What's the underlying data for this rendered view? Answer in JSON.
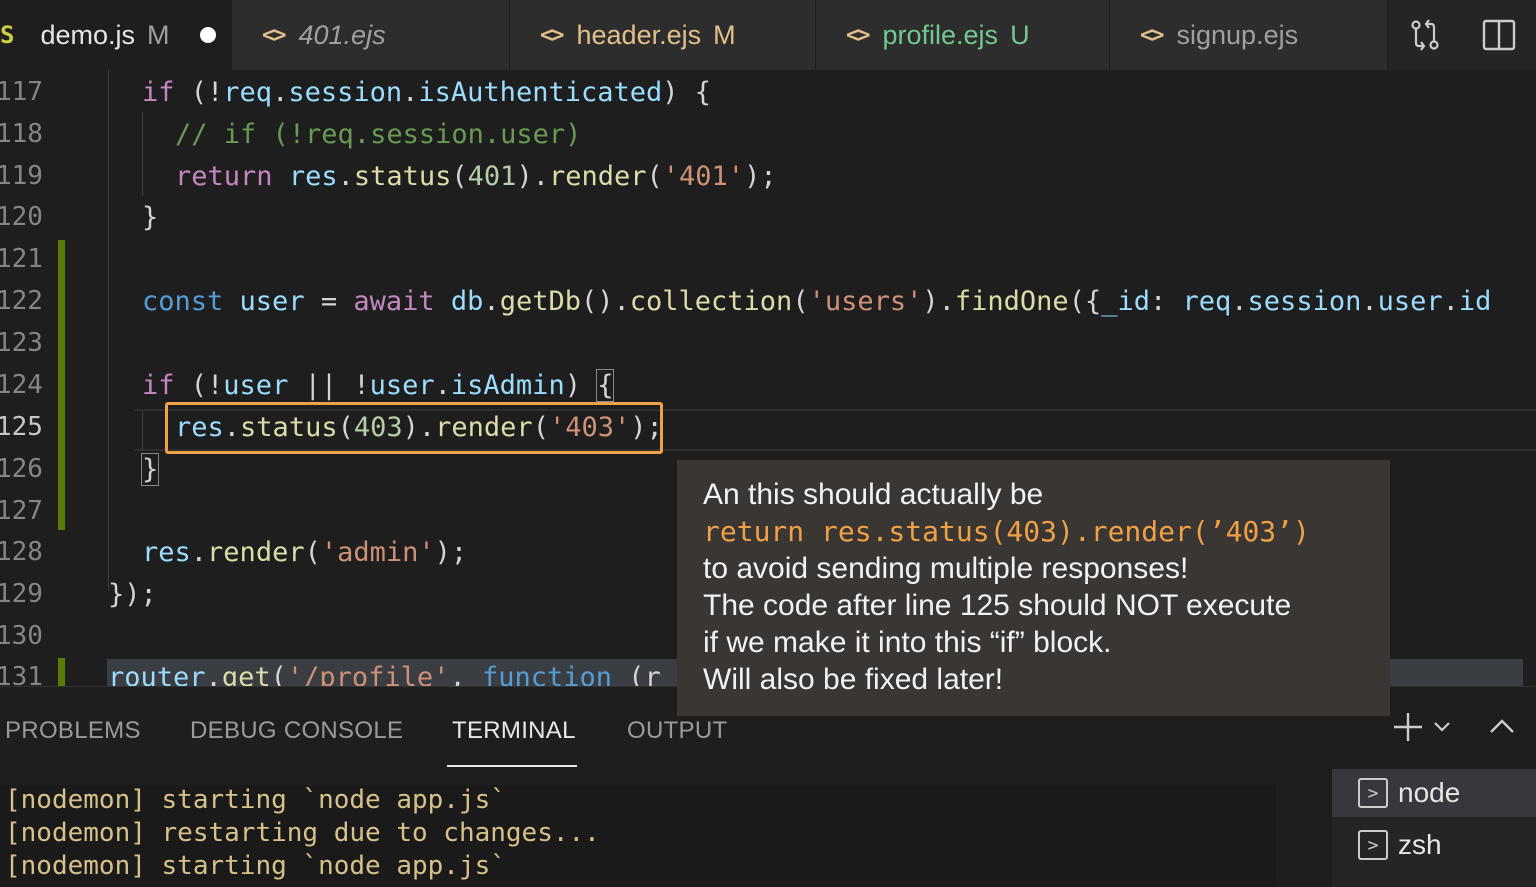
{
  "tabs": [
    {
      "icon": "S",
      "name": "demo.js",
      "status": "M",
      "dirty": true
    },
    {
      "icon": "<>",
      "name": "401.ejs",
      "status": ""
    },
    {
      "icon": "<>",
      "name": "header.ejs",
      "status": "M"
    },
    {
      "icon": "<>",
      "name": "profile.ejs",
      "status": "U"
    },
    {
      "icon": "<>",
      "name": "signup.ejs",
      "status": ""
    }
  ],
  "editor": {
    "line_numbers": [
      "117",
      "118",
      "119",
      "120",
      "121",
      "122",
      "123",
      "124",
      "125",
      "126",
      "127",
      "128",
      "129",
      "130",
      "131"
    ],
    "current_line": "125"
  },
  "code": {
    "l117": [
      "if",
      " (!",
      "req",
      ".",
      "session",
      ".",
      "isAuthenticated",
      ") {"
    ],
    "l118": "// if (!req.session.user)",
    "l119": [
      "return",
      " ",
      "res",
      ".",
      "status",
      "(",
      "401",
      ").",
      "render",
      "(",
      "'401'",
      ");"
    ],
    "l120": "}",
    "l122": [
      "const",
      " ",
      "user",
      " = ",
      "await",
      " ",
      "db",
      ".",
      "getDb",
      "().",
      "collection",
      "(",
      "'users'",
      ").",
      "findOne",
      "({",
      "_id",
      ": ",
      "req",
      ".",
      "session",
      ".",
      "user",
      ".",
      "id"
    ],
    "l124": [
      "if",
      " (!",
      "user",
      " || !",
      "user",
      ".",
      "isAdmin",
      ") ",
      "{"
    ],
    "l125": [
      "res",
      ".",
      "status",
      "(",
      "403",
      ").",
      "render",
      "(",
      "'403'",
      ")",
      ";"
    ],
    "l126": "}",
    "l128": [
      "res",
      ".",
      "render",
      "(",
      "'admin'",
      ");"
    ],
    "l129": "});",
    "l131": [
      "router",
      ".",
      "get",
      "(",
      "'/profile'",
      ", ",
      "function",
      " (r"
    ]
  },
  "tooltip": {
    "line1": "An this should actually be",
    "line2": "return res.status(403).render(’403’)",
    "line3": "to avoid sending multiple responses!",
    "line4": "The code after line 125 should NOT execute",
    "line5": "if we make it into this “if” block.",
    "line6": "Will also be fixed later!"
  },
  "panel": {
    "tabs": [
      "PROBLEMS",
      "DEBUG CONSOLE",
      "TERMINAL",
      "OUTPUT"
    ],
    "active_tab": "TERMINAL",
    "terminal_lines": [
      "[nodemon] starting `node app.js`",
      "[nodemon] restarting due to changes...",
      "[nodemon] starting `node app.js`"
    ],
    "terminals": [
      "node",
      "zsh"
    ]
  },
  "colors": {
    "accent_box": "#f0a045",
    "git_modified": "#587c0c"
  }
}
